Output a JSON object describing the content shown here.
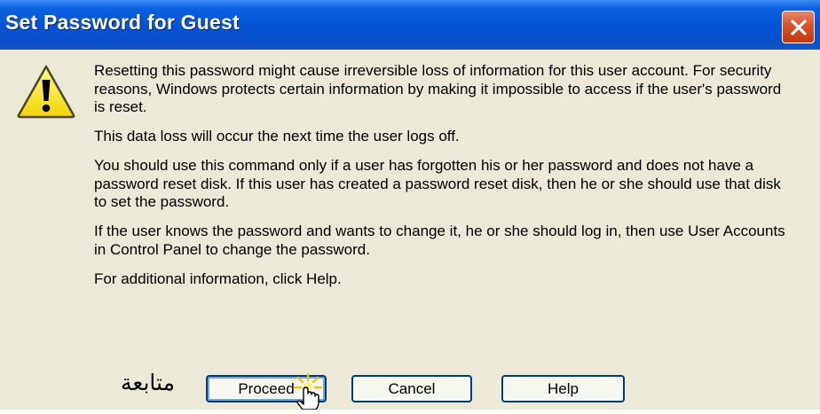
{
  "window": {
    "title": "Set Password for Guest",
    "close_icon": "close-icon"
  },
  "icon": "warning-icon",
  "messages": [
    "Resetting this password might cause irreversible loss of information for this user account. For security reasons, Windows protects certain information by making it impossible to access if the user's password is reset.",
    "This data loss will occur the next time the user logs off.",
    "You should use this command only if a user has forgotten his or her password and does not have a password reset disk. If this user has created a password reset disk, then he or she should use that disk to set the password.",
    "If the user knows the password and wants to change it, he or she should log in, then use User Accounts in Control Panel to change the password.",
    "For additional information, click Help."
  ],
  "annotation": "متابعة",
  "buttons": {
    "proceed": "Proceed",
    "cancel": "Cancel",
    "help": "Help"
  },
  "colors": {
    "titlebar": "#0553d6",
    "dialog_bg": "#ece9d8",
    "button_border": "#003c74",
    "close_button": "#d9532b"
  }
}
